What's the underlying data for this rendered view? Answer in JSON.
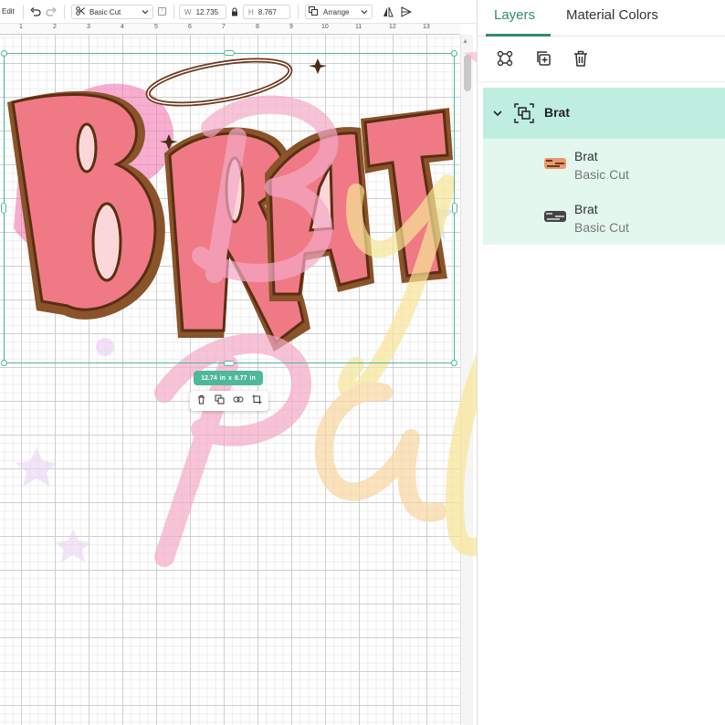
{
  "toolbar": {
    "edit_label": "Edit",
    "operation_value": "Basic Cut",
    "width_label": "W",
    "width_value": "12.735",
    "height_label": "H",
    "height_value": "8.767",
    "arrange_label": "Arrange"
  },
  "ruler": {
    "numbers": [
      "1",
      "2",
      "3",
      "4",
      "5",
      "6",
      "7",
      "8",
      "9",
      "10",
      "11",
      "12",
      "13"
    ]
  },
  "selection": {
    "width": "12.74",
    "width_unit": "in",
    "times": "x",
    "height": "8.77",
    "height_unit": "in"
  },
  "artwork": {
    "design_text": "BRAT",
    "watermark_text_1": "By",
    "watermark_text_2": "Pal"
  },
  "panel": {
    "tabs": [
      {
        "label": "Layers",
        "active": true
      },
      {
        "label": "Material Colors",
        "active": false
      }
    ],
    "group": {
      "label": "Brat"
    },
    "layers": [
      {
        "name": "Brat",
        "operation": "Basic Cut"
      },
      {
        "name": "Brat",
        "operation": "Basic Cut"
      }
    ]
  },
  "colors": {
    "accent": "#2e8b6e",
    "selection": "#4fb79a",
    "group_bg": "#bfeee0",
    "children_bg": "#e3f7ef",
    "letter_fill": "#ef7a86",
    "letter_outline": "#6b3a1c"
  }
}
